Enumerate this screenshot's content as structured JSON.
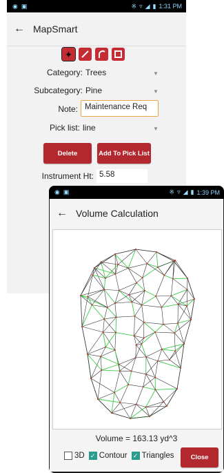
{
  "back_screen": {
    "status": {
      "time": "1:31 PM"
    },
    "app_title": "MapSmart",
    "tools": [
      {
        "name": "point-tool-icon",
        "active": true
      },
      {
        "name": "line-tool-icon",
        "active": false
      },
      {
        "name": "arc-tool-icon",
        "active": false
      },
      {
        "name": "rectangle-tool-icon",
        "active": false
      }
    ],
    "category_label": "Category:",
    "category_value": "Trees",
    "subcategory_label": "Subcategory:",
    "subcategory_value": "Pine",
    "note_label": "Note:",
    "note_value": "Maintenance Req",
    "picklist_label": "Pick list:",
    "picklist_value": "line",
    "delete_label": "Delete",
    "add_label": "Add To Pick List",
    "instrument_label": "Instrument Ht:",
    "instrument_value": "5.58"
  },
  "front_screen": {
    "status": {
      "time": "1:39 PM"
    },
    "title": "Volume Calculation",
    "volume_text": "Volume = 163.13 yd^3",
    "options": [
      {
        "label": "3D",
        "checked": false
      },
      {
        "label": "Contour",
        "checked": true
      },
      {
        "label": "Triangles",
        "checked": true
      }
    ],
    "close_label": "Close",
    "colors": {
      "accent": "#b3282e",
      "triangle_edge": "#222222",
      "contour_edge": "#3cc94a",
      "vertex": "#c0392b"
    }
  }
}
